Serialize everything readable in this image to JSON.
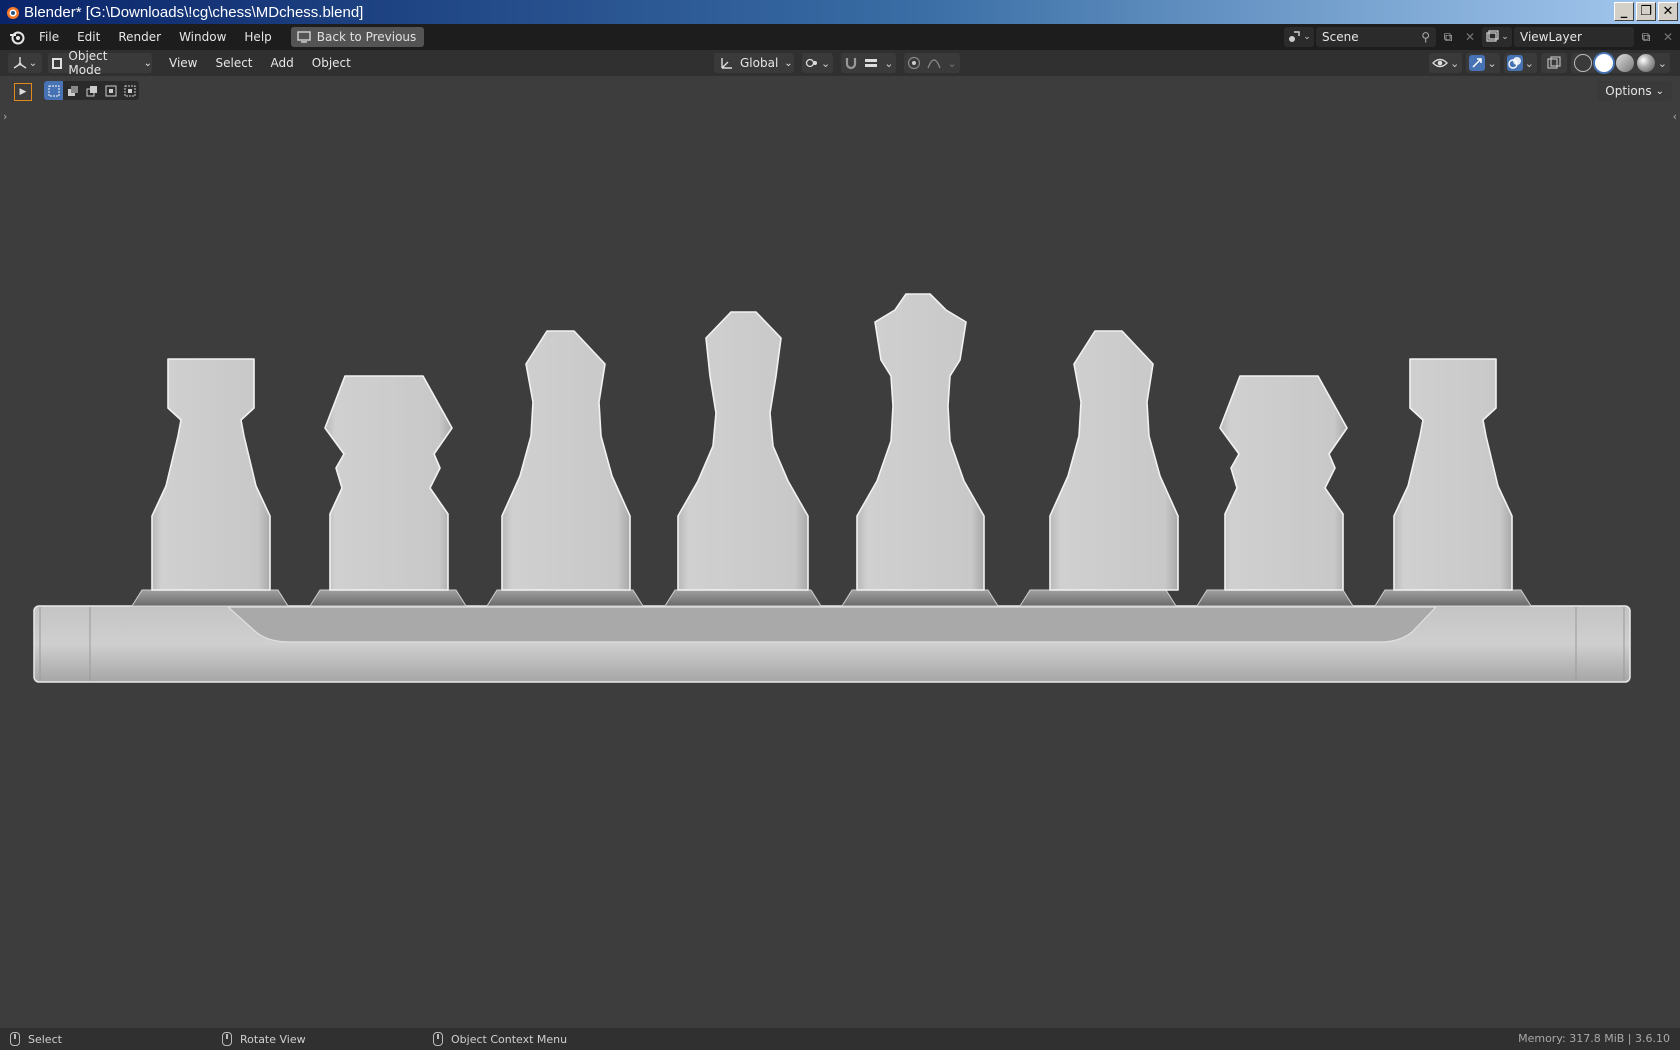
{
  "window": {
    "title": "Blender* [G:\\Downloads\\!cg\\chess\\MDchess.blend]",
    "controls": [
      "_",
      "❐",
      "✕"
    ]
  },
  "topbar": {
    "menus": [
      "File",
      "Edit",
      "Render",
      "Window",
      "Help"
    ],
    "back_button": "Back to Previous",
    "scene": "Scene",
    "view_layer": "ViewLayer"
  },
  "viewport_header": {
    "mode": "Object Mode",
    "menus": [
      "View",
      "Select",
      "Add",
      "Object"
    ],
    "transform_orientation": "Global",
    "options_label": "Options"
  },
  "statusbar": {
    "select": "Select",
    "rotate_view": "Rotate View",
    "context_menu": "Object Context Menu",
    "memory": "Memory: 317.8 MiB | 3.6.10"
  },
  "scene_objects": {
    "pieces": [
      "rook",
      "knight",
      "bishop",
      "queen",
      "king",
      "bishop",
      "knight",
      "rook"
    ],
    "colors": {
      "piece": "#c8c8c8",
      "background": "#3d3d3d"
    }
  }
}
